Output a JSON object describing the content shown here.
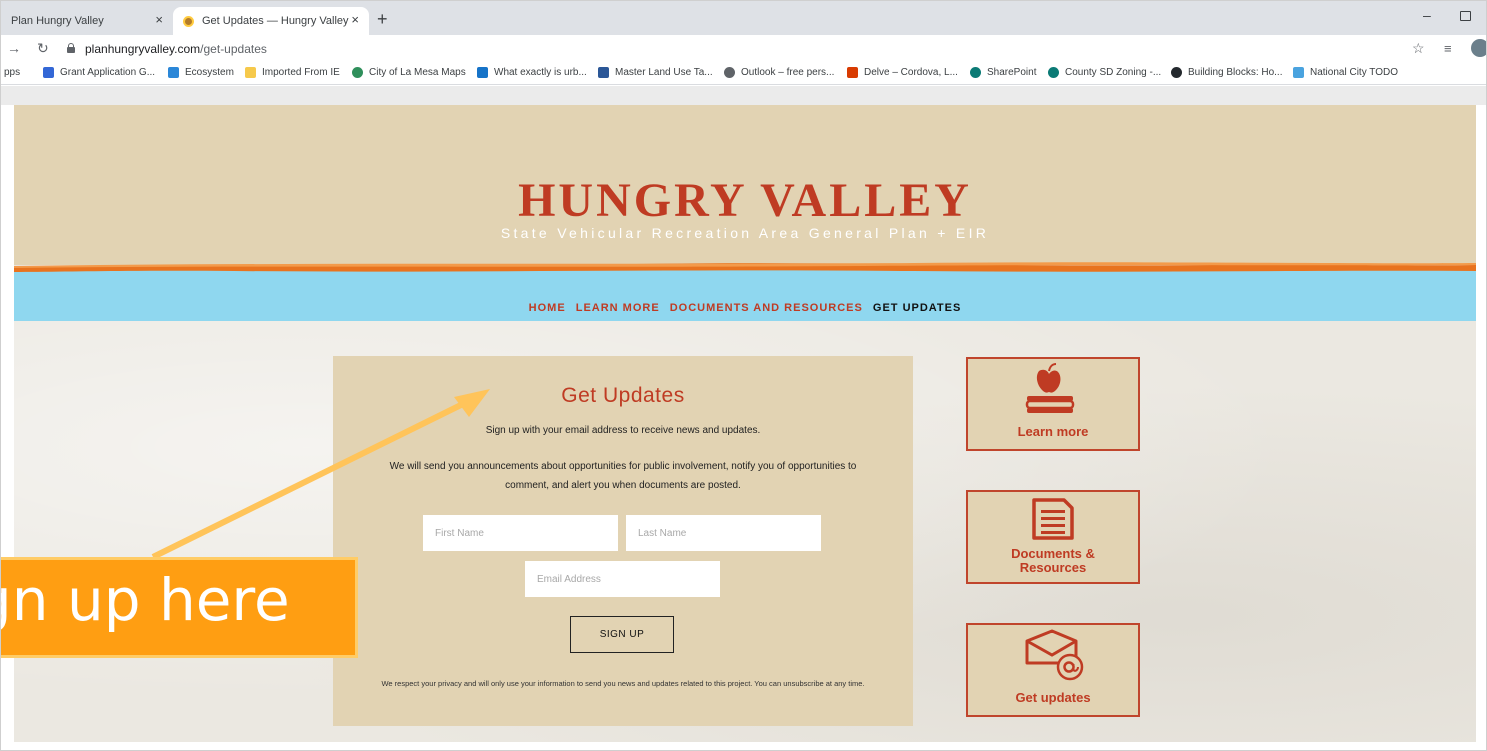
{
  "browser": {
    "tabs": [
      {
        "title": "Plan Hungry Valley",
        "active": false
      },
      {
        "title": "Get Updates — Hungry Valley",
        "active": true
      }
    ],
    "close_glyph": "×",
    "new_tab_glyph": "+",
    "url_host": "planhungryvalley.com",
    "url_path": "/get-updates",
    "apps_label": "pps",
    "bookmarks": [
      {
        "label": "Grant Application G...",
        "icon": "grid-icon",
        "color": "#3367d6"
      },
      {
        "label": "Ecosystem",
        "icon": "doc-icon",
        "color": "#2b87d8"
      },
      {
        "label": "Imported From IE",
        "icon": "folder-icon",
        "color": "#f6c94b"
      },
      {
        "label": "City of La Mesa Maps",
        "icon": "globe-icon",
        "color": "#2f8f5b"
      },
      {
        "label": "What exactly is urb...",
        "icon": "page-icon",
        "color": "#1673c8"
      },
      {
        "label": "Master Land Use Ta...",
        "icon": "word-icon",
        "color": "#2b5797"
      },
      {
        "label": "Outlook – free pers...",
        "icon": "outlook-icon",
        "color": "#5f6368"
      },
      {
        "label": "Delve – Cordova, L...",
        "icon": "office-icon",
        "color": "#d83b01"
      },
      {
        "label": "SharePoint",
        "icon": "sharepoint-icon",
        "color": "#0b7a75"
      },
      {
        "label": "County SD Zoning -...",
        "icon": "sharepoint-icon",
        "color": "#0b7a75"
      },
      {
        "label": "Building Blocks: Ho...",
        "icon": "github-icon",
        "color": "#24292e"
      },
      {
        "label": "National City TODO",
        "icon": "landscape-icon",
        "color": "#4aa3df"
      }
    ]
  },
  "site": {
    "title": "HUNGRY VALLEY",
    "subtitle": "State Vehicular Recreation Area General Plan + EIR",
    "nav": [
      {
        "label": "HOME",
        "current": false
      },
      {
        "label": "LEARN MORE",
        "current": false
      },
      {
        "label": "DOCUMENTS AND RESOURCES",
        "current": false
      },
      {
        "label": "GET UPDATES",
        "current": true
      }
    ],
    "colors": {
      "accent": "#bf3b23",
      "sand": "#e2d3b3",
      "sky": "#8fd7ef",
      "orange": "#ff9e12"
    }
  },
  "form": {
    "title": "Get Updates",
    "intro": "Sign up with your email address to receive news and updates.",
    "body": "We will send you announcements about opportunities for public involvement, notify you of opportunities to comment, and alert you when documents are posted.",
    "first_name_placeholder": "First Name",
    "last_name_placeholder": "Last Name",
    "email_placeholder": "Email Address",
    "submit_label": "SIGN UP",
    "privacy": "We respect your privacy and will only use your information to send you news and updates related to this project. You can unsubscribe at any time."
  },
  "cards": [
    {
      "label": "Learn more",
      "icon": "apple-book-icon"
    },
    {
      "label": "Documents & Resources",
      "label_line1": "Documents &",
      "label_line2": "Resources",
      "icon": "document-icon"
    },
    {
      "label": "Get updates",
      "icon": "envelope-at-icon"
    }
  ],
  "annotation": {
    "callout_text": "Sign up here"
  }
}
